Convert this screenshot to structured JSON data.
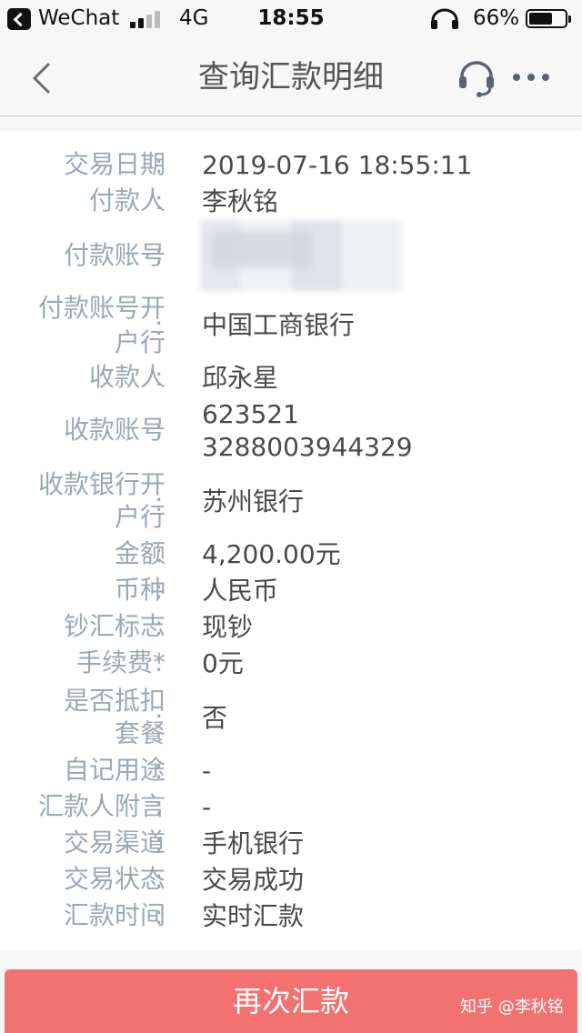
{
  "status_bar": {
    "app": "WeChat",
    "network": "4G",
    "time": "18:55",
    "battery_percent_label": "66%",
    "battery_level": 0.66
  },
  "nav": {
    "title": "查询汇款明细"
  },
  "details": [
    {
      "label": "交易日期",
      "colon": ":",
      "value": "2019-07-16 18:55:11"
    },
    {
      "label": "付款人",
      "colon": ":",
      "value": "李秋铭"
    },
    {
      "label": "付款账号",
      "colon": ":",
      "value": ""
    },
    {
      "label1": "付款账号开",
      "label2": "户行",
      "colon": ":",
      "value": "中国工商银行"
    },
    {
      "label": "收款人",
      "colon": ":",
      "value": "邱永星"
    },
    {
      "label": "收款账号",
      "colon": ":",
      "value1": "623521",
      "value2": "3288003944329"
    },
    {
      "label1": "收款银行开",
      "label2": "户行",
      "colon": ":",
      "value": "苏州银行"
    },
    {
      "label": "金额",
      "colon": ":",
      "value": "4,200.00元"
    },
    {
      "label": "币种",
      "colon": ":",
      "value": "人民币"
    },
    {
      "label": "钞汇标志",
      "colon": ":",
      "value": "现钞"
    },
    {
      "label": "手续费*",
      "colon": ":",
      "value": "0元"
    },
    {
      "label1": "是否抵扣",
      "label2": "套餐",
      "colon": ":",
      "value": "否"
    },
    {
      "label": "自记用途",
      "colon": ":",
      "value": "-"
    },
    {
      "label": "汇款人附言",
      "colon": ":",
      "value": "-"
    },
    {
      "label": "交易渠道",
      "colon": ":",
      "value": "手机银行"
    },
    {
      "label": "交易状态",
      "colon": ":",
      "value": "交易成功"
    },
    {
      "label": "汇款时间",
      "colon": ":",
      "value": "实时汇款"
    }
  ],
  "footer": {
    "button_label": "再次汇款",
    "watermark": "知乎 @李秋铭"
  },
  "colors": {
    "label": "#9aa9b6",
    "value": "#4a4a4a",
    "button": "#f27272"
  }
}
